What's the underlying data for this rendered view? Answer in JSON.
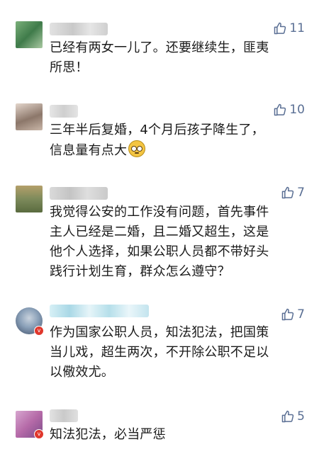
{
  "comments": [
    {
      "likes": "11",
      "text_lines": [
        "已经有两女一儿了。还要继续生，匪夷",
        "所思！"
      ],
      "avatar_colors": [
        "#7bb07a",
        "#3f7b4a",
        "#a9c9a2"
      ],
      "name_color": "#d6d6d6"
    },
    {
      "likes": "10",
      "text_lines": [
        "三年半后复婚，4个月后孩子降生了，",
        "信息量有点大"
      ],
      "emoji": "pleading-face-emoji",
      "avatar_colors": [
        "#c9b6a8",
        "#8c776a",
        "#e4d6cc"
      ],
      "name_color": "#d9d9d9"
    },
    {
      "likes": "7",
      "text_lines": [
        "我觉得公安的工作没有问题，首先事件",
        "主人已经是二婚，且二婚又超生，这是",
        "他个人选择，如果公职人员都不带好头",
        "践行计划生育，群众怎么遵守？"
      ],
      "avatar_colors": [
        "#7d8a5b",
        "#b4a06a",
        "#5a6b3f"
      ],
      "name_color": "#cfcfcf"
    },
    {
      "likes": "7",
      "text_lines": [
        "作为国家公职人员，知法犯法，把国策",
        "当儿戏，超生两次，不开除公职不足以",
        "以儆效尤。"
      ],
      "avatar_colors": [
        "#3e4e69",
        "#8aa0b8",
        "#c8d2dd"
      ],
      "name_color": "#bfe3ee"
    },
    {
      "likes": "5",
      "text_lines": [
        "知法犯法，必当严惩"
      ],
      "avatar_colors": [
        "#b56aa8",
        "#7c4c8a",
        "#d7a6cf"
      ],
      "name_color": "#d3d3d3"
    }
  ],
  "icons": {
    "like": "thumbs-up-icon",
    "verified": "v-badge-icon"
  },
  "colors": {
    "like": "#5a6f94",
    "text": "#1a1a1a",
    "badge": "#e0372c"
  }
}
